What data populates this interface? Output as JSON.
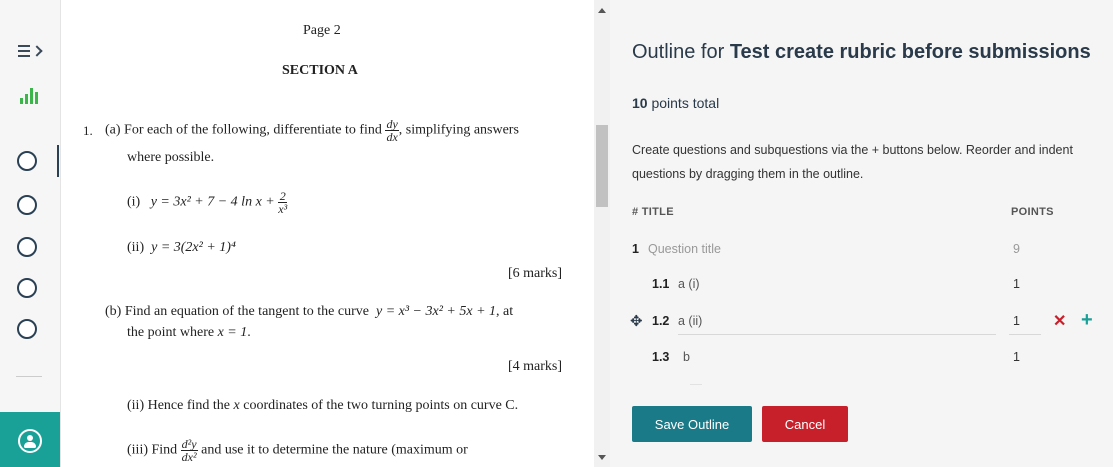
{
  "rail": {
    "icons": {
      "menu": "hamburger-chevron-icon",
      "stats": "bar-chart-icon",
      "question": "circle-icon",
      "user": "user-circle-icon"
    },
    "accent": "#1aa197"
  },
  "document": {
    "page_label": "Page 2",
    "section": "SECTION A",
    "q1_num": "1.",
    "q1a_intro": "(a)  For each of the following, differentiate to find",
    "dy": "dy",
    "dx": "dx",
    "q1a_tail": ", simplifying answers",
    "q1a_line2": "where possible.",
    "i_label": "(i)",
    "i_expr": "y = 3x² + 7 − 4 ln x +",
    "i_num": "2",
    "i_den": "x³",
    "ii_label": "(ii)",
    "ii_expr": "y = 3(2x² + 1)⁴",
    "marks_a": "[6 marks]",
    "q1b_line1": "(b)  Find an equation of the tangent to the curve",
    "q1b_expr": "y = x³ − 3x² + 5x + 1",
    "q1b_tail": ", at",
    "q1b_line2a": "the point where",
    "q1b_line2b": "x = 1",
    "q1b_line2c": ".",
    "marks_b": "[4 marks]",
    "q1b_ii": "(ii)  Hence find the",
    "q1b_ii_x": "x",
    "q1b_ii_tail": "coordinates of the two turning points on curve C.",
    "q1b_iii_label": "(iii)  Find",
    "d2y": "d²y",
    "dx2": "dx²",
    "q1b_iii_tail": "and use it to determine the nature (maximum or"
  },
  "panel": {
    "title_prefix": "Outline for ",
    "title_bold": "Test create rubric before submissions",
    "points_value": "10",
    "points_suffix": " points total",
    "help": "Create questions and subquestions via the + buttons below. Reorder and indent questions by dragging them in the outline.",
    "col_title": "# TITLE",
    "col_points": "POINTS",
    "rows": [
      {
        "num": "1",
        "title": "Question title",
        "points": "9"
      },
      {
        "num": "1.1",
        "title": "a (i)",
        "points": "1"
      },
      {
        "num": "1.2",
        "title": "a (ii)",
        "points": "1"
      },
      {
        "num": "1.3",
        "title": "b",
        "points": "1"
      }
    ],
    "save_label": "Save Outline",
    "cancel_label": "Cancel",
    "colors": {
      "save": "#1b7a87",
      "cancel": "#c8202b",
      "add": "#1aa197"
    }
  }
}
